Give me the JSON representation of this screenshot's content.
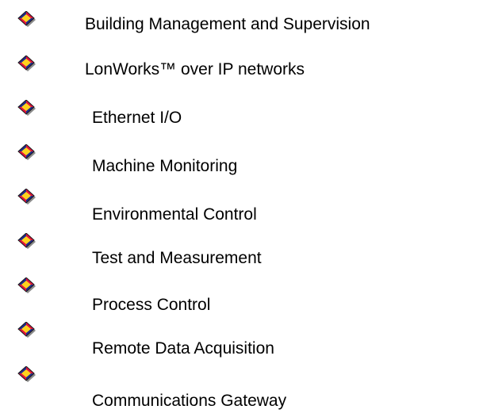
{
  "bullet_icon": "diamond-bullet-icon",
  "colors": {
    "bullet_outline": "#1a1a1a",
    "bullet_red": "#e0143c",
    "bullet_blue": "#1e2a8c",
    "bullet_yellow": "#ffd21e",
    "bullet_shadow": "#8c8c8c",
    "text": "#000000"
  },
  "items": [
    {
      "label": "Building Management and Supervision"
    },
    {
      "label": "LonWorks™ over IP networks"
    },
    {
      "label": "Ethernet I/O"
    },
    {
      "label": "Machine Monitoring"
    },
    {
      "label": "Environmental Control"
    },
    {
      "label": "Test and Measurement"
    },
    {
      "label": "Process Control"
    },
    {
      "label": "Remote Data Acquisition"
    },
    {
      "label": "Communications Gateway"
    }
  ]
}
